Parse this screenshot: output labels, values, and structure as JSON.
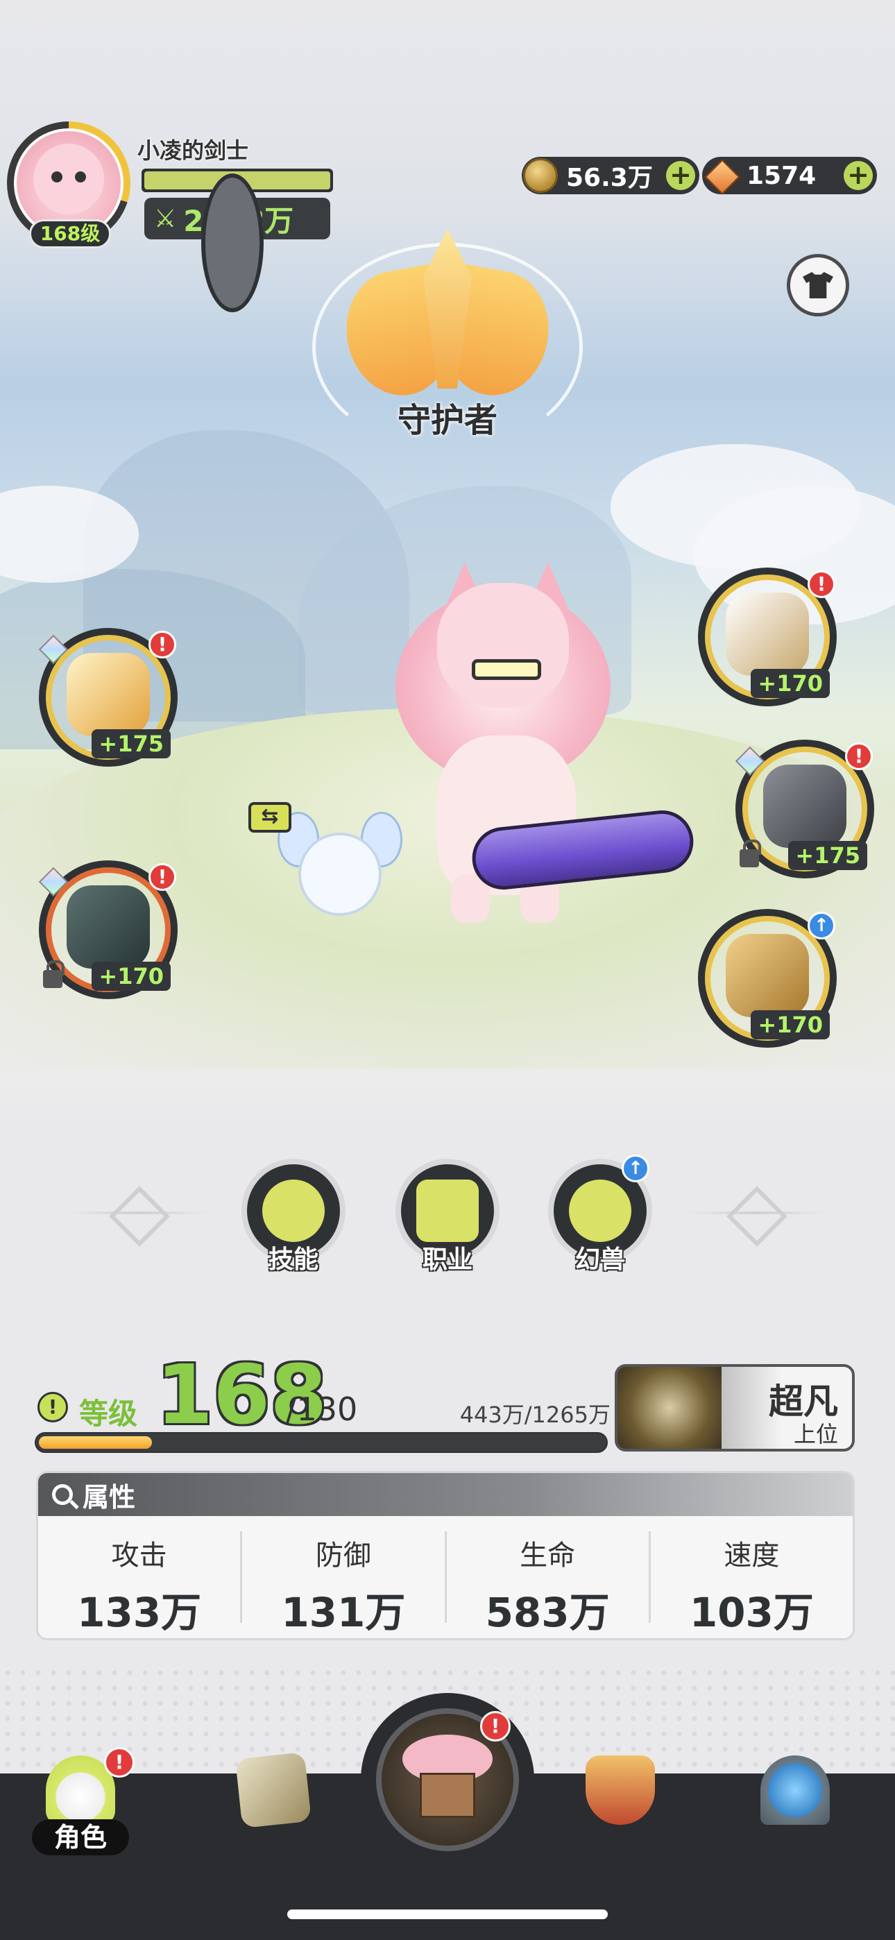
{
  "player": {
    "name": "小凌的剑士",
    "level": "168级",
    "power": "2278万"
  },
  "currency": {
    "coins": "56.3万",
    "gems": "1574",
    "plus": "+"
  },
  "class": {
    "name": "守护者"
  },
  "equipment": {
    "left": [
      {
        "bonus": "+175",
        "badge": "!"
      },
      {
        "bonus": "+170",
        "badge": "!"
      }
    ],
    "right": [
      {
        "bonus": "+170",
        "badge": "!"
      },
      {
        "bonus": "+175",
        "badge": "!"
      },
      {
        "bonus": "+170",
        "badge": "↑"
      }
    ]
  },
  "functions": {
    "skill": "技能",
    "job": "职业",
    "beast": "幻兽",
    "upgrade_badge": "↑"
  },
  "level_info": {
    "alert": "!",
    "label": "等级",
    "current": "168",
    "max": "/130",
    "exp": "443万/1265万",
    "progress": 0.2
  },
  "rank": {
    "name": "超凡",
    "sub": "上位"
  },
  "attributes": {
    "title": "属性",
    "items": [
      {
        "name": "攻击",
        "value": "133万"
      },
      {
        "name": "防御",
        "value": "131万"
      },
      {
        "name": "生命",
        "value": "583万"
      },
      {
        "name": "速度",
        "value": "103万"
      }
    ]
  },
  "nav": {
    "character": "角色",
    "alert": "!"
  },
  "colors": {
    "accent_green": "#8ccd4b",
    "alert_red": "#e23b3b",
    "upgrade_blue": "#3b8be2",
    "dark": "#2f3235"
  }
}
